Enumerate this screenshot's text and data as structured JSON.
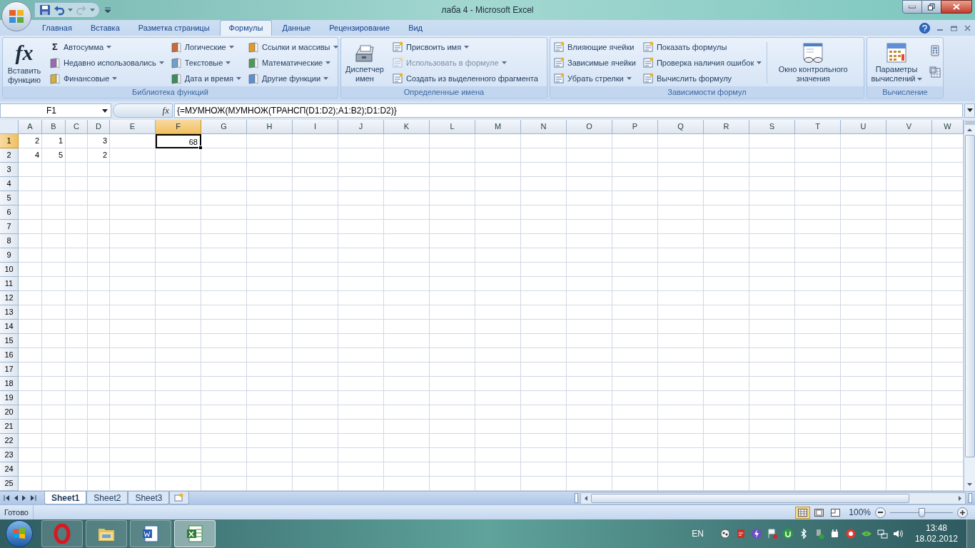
{
  "window": {
    "title": "лаба 4 - Microsoft Excel"
  },
  "tabs": [
    {
      "label": "Главная",
      "selected": false
    },
    {
      "label": "Вставка",
      "selected": false
    },
    {
      "label": "Разметка страницы",
      "selected": false
    },
    {
      "label": "Формулы",
      "selected": true
    },
    {
      "label": "Данные",
      "selected": false
    },
    {
      "label": "Рецензирование",
      "selected": false
    },
    {
      "label": "Вид",
      "selected": false
    }
  ],
  "ribbon": {
    "groups": [
      {
        "label": "Библиотека функций",
        "controls": [
          {
            "kind": "large",
            "glyph": "fx",
            "label": "Вставить функцию",
            "dropdown": false
          },
          {
            "kind": "stack",
            "items": [
              {
                "kind": "button",
                "glyph": "Σ",
                "label": "Автосумма",
                "dropdown": true,
                "disabled": false
              },
              {
                "kind": "button",
                "label": "Недавно использовались",
                "dropdown": true,
                "disabled": false
              },
              {
                "kind": "button",
                "label": "Финансовые",
                "dropdown": true,
                "disabled": false
              }
            ]
          },
          {
            "kind": "stack",
            "items": [
              {
                "kind": "button",
                "label": "Логические",
                "dropdown": true,
                "disabled": false
              },
              {
                "kind": "button",
                "label": "Текстовые",
                "dropdown": true,
                "disabled": false
              },
              {
                "kind": "button",
                "label": "Дата и время",
                "dropdown": true,
                "disabled": false
              }
            ]
          },
          {
            "kind": "stack",
            "items": [
              {
                "kind": "button",
                "label": "Ссылки и массивы",
                "dropdown": true,
                "disabled": false
              },
              {
                "kind": "button",
                "label": "Математические",
                "dropdown": true,
                "disabled": false
              },
              {
                "kind": "button",
                "label": "Другие функции",
                "dropdown": true,
                "disabled": false
              }
            ]
          }
        ]
      },
      {
        "label": "Определенные имена",
        "controls": [
          {
            "kind": "large",
            "label": "Диспетчер имен",
            "dropdown": false
          },
          {
            "kind": "stack",
            "items": [
              {
                "kind": "button",
                "label": "Присвоить имя",
                "dropdown": true,
                "disabled": false
              },
              {
                "kind": "button",
                "label": "Использовать в формуле",
                "dropdown": true,
                "disabled": true
              },
              {
                "kind": "button",
                "label": "Создать из выделенного фрагмента",
                "dropdown": false,
                "disabled": false
              }
            ]
          }
        ]
      },
      {
        "label": "Зависимости формул",
        "controls": [
          {
            "kind": "stack",
            "items": [
              {
                "kind": "button",
                "label": "Влияющие ячейки",
                "dropdown": false,
                "disabled": false
              },
              {
                "kind": "button",
                "label": "Зависимые ячейки",
                "dropdown": false,
                "disabled": false
              },
              {
                "kind": "button",
                "label": "Убрать стрелки",
                "dropdown": true,
                "disabled": false
              }
            ]
          },
          {
            "kind": "stack",
            "items": [
              {
                "kind": "button",
                "label": "Показать формулы",
                "dropdown": false,
                "disabled": false
              },
              {
                "kind": "button",
                "label": "Проверка наличия ошибок",
                "dropdown": true,
                "disabled": false
              },
              {
                "kind": "button",
                "label": "Вычислить формулу",
                "dropdown": false,
                "disabled": false
              }
            ]
          },
          {
            "kind": "separator"
          },
          {
            "kind": "large",
            "label": "Окно контрольного значения",
            "dropdown": false
          }
        ]
      },
      {
        "label": "Вычисление",
        "controls": [
          {
            "kind": "large",
            "label": "Параметры вычислений",
            "dropdown": true
          },
          {
            "kind": "stack",
            "items": [
              {
                "kind": "icon",
                "disabled": false
              },
              {
                "kind": "icon",
                "disabled": false
              }
            ]
          }
        ]
      }
    ]
  },
  "formula_bar": {
    "name_box": "F1",
    "fx": "fx",
    "formula": "{=МУМНОЖ(МУМНОЖ(ТРАНСП(D1:D2);A1:B2);D1:D2)}"
  },
  "sheet": {
    "columns": [
      {
        "label": "A",
        "selected": false
      },
      {
        "label": "B",
        "selected": false
      },
      {
        "label": "C",
        "selected": false
      },
      {
        "label": "D",
        "selected": false
      },
      {
        "label": "E",
        "selected": false
      },
      {
        "label": "F",
        "selected": true
      },
      {
        "label": "G",
        "selected": false
      },
      {
        "label": "H",
        "selected": false
      },
      {
        "label": "I",
        "selected": false
      },
      {
        "label": "J",
        "selected": false
      },
      {
        "label": "K",
        "selected": false
      },
      {
        "label": "L",
        "selected": false
      },
      {
        "label": "M",
        "selected": false
      },
      {
        "label": "N",
        "selected": false
      },
      {
        "label": "O",
        "selected": false
      },
      {
        "label": "P",
        "selected": false
      },
      {
        "label": "Q",
        "selected": false
      },
      {
        "label": "R",
        "selected": false
      },
      {
        "label": "S",
        "selected": false
      },
      {
        "label": "T",
        "selected": false
      },
      {
        "label": "U",
        "selected": false
      },
      {
        "label": "V",
        "selected": false
      },
      {
        "label": "W",
        "selected": false
      }
    ],
    "rows": [
      {
        "label": "1",
        "selected": true,
        "cells": [
          {
            "value": "2",
            "selected": false
          },
          {
            "value": "1",
            "selected": false
          },
          null,
          {
            "value": "3",
            "selected": false
          },
          null,
          {
            "value": "68",
            "selected": true
          }
        ]
      },
      {
        "label": "2",
        "selected": false,
        "cells": [
          {
            "value": "4",
            "selected": false
          },
          {
            "value": "5",
            "selected": false
          },
          null,
          {
            "value": "2",
            "selected": false
          }
        ]
      },
      {
        "label": "3",
        "selected": false
      },
      {
        "label": "4",
        "selected": false
      },
      {
        "label": "5",
        "selected": false
      },
      {
        "label": "6",
        "selected": false
      },
      {
        "label": "7",
        "selected": false
      },
      {
        "label": "8",
        "selected": false
      },
      {
        "label": "9",
        "selected": false
      },
      {
        "label": "10",
        "selected": false
      },
      {
        "label": "11",
        "selected": false
      },
      {
        "label": "12",
        "selected": false
      },
      {
        "label": "13",
        "selected": false
      },
      {
        "label": "14",
        "selected": false
      },
      {
        "label": "15",
        "selected": false
      },
      {
        "label": "16",
        "selected": false
      },
      {
        "label": "17",
        "selected": false
      },
      {
        "label": "18",
        "selected": false
      },
      {
        "label": "19",
        "selected": false
      },
      {
        "label": "20",
        "selected": false
      },
      {
        "label": "21",
        "selected": false
      },
      {
        "label": "22",
        "selected": false
      },
      {
        "label": "23",
        "selected": false
      },
      {
        "label": "24",
        "selected": false
      },
      {
        "label": "25",
        "selected": false
      }
    ]
  },
  "sheet_tabs": [
    {
      "label": "Sheet1",
      "selected": true
    },
    {
      "label": "Sheet2",
      "selected": false
    },
    {
      "label": "Sheet3",
      "selected": false
    }
  ],
  "status_bar": {
    "status": "Готово",
    "views": [
      {
        "kind": "normal",
        "selected": true
      },
      {
        "kind": "layout",
        "selected": false
      },
      {
        "kind": "pagebreak",
        "selected": false
      }
    ],
    "zoom": "100%",
    "zoom_slider": {
      "level": 0.5
    }
  },
  "taskbar": {
    "apps": [
      {
        "kind": "browser",
        "selected": false
      },
      {
        "kind": "folder",
        "selected": false
      },
      {
        "kind": "word",
        "selected": false
      },
      {
        "kind": "excel",
        "selected": true
      }
    ],
    "language": "EN",
    "time": "13:48",
    "date": "18.02.2012"
  }
}
